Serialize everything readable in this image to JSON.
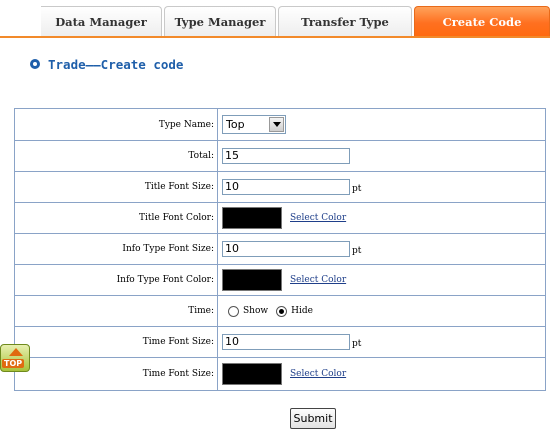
{
  "tabs": [
    {
      "label": "Data Manager"
    },
    {
      "label": "Type Manager"
    },
    {
      "label": "Transfer Type"
    },
    {
      "label": "Create Code",
      "active": true
    }
  ],
  "heading": "Trade——Create code",
  "form": {
    "type_name": {
      "label": "Type Name:",
      "value": "Top"
    },
    "total": {
      "label": "Total:",
      "value": "15"
    },
    "title_font_size": {
      "label": "Title Font Size:",
      "value": "10",
      "unit": "pt"
    },
    "title_font_color": {
      "label": "Title Font Color:",
      "color": "#000000",
      "link": "Select Color"
    },
    "info_type_font_size": {
      "label": "Info Type Font Size:",
      "value": "10",
      "unit": "pt"
    },
    "info_type_font_color": {
      "label": "Info Type Font Color:",
      "color": "#000000",
      "link": "Select Color"
    },
    "time": {
      "label": "Time:",
      "options": [
        "Show",
        "Hide"
      ],
      "selected": "Hide"
    },
    "time_font_size": {
      "label": "Time Font Size:",
      "value": "10",
      "unit": "pt"
    },
    "time_font_color": {
      "label": "Time Font Size:",
      "color": "#000000",
      "link": "Select Color"
    }
  },
  "submit_label": "Submit",
  "top_badge": {
    "text": "TOP",
    "icon": "up-arrow-icon"
  },
  "colors": {
    "accent": "#ff7020",
    "border": "#8aa3c7",
    "heading": "#1f5faa"
  }
}
